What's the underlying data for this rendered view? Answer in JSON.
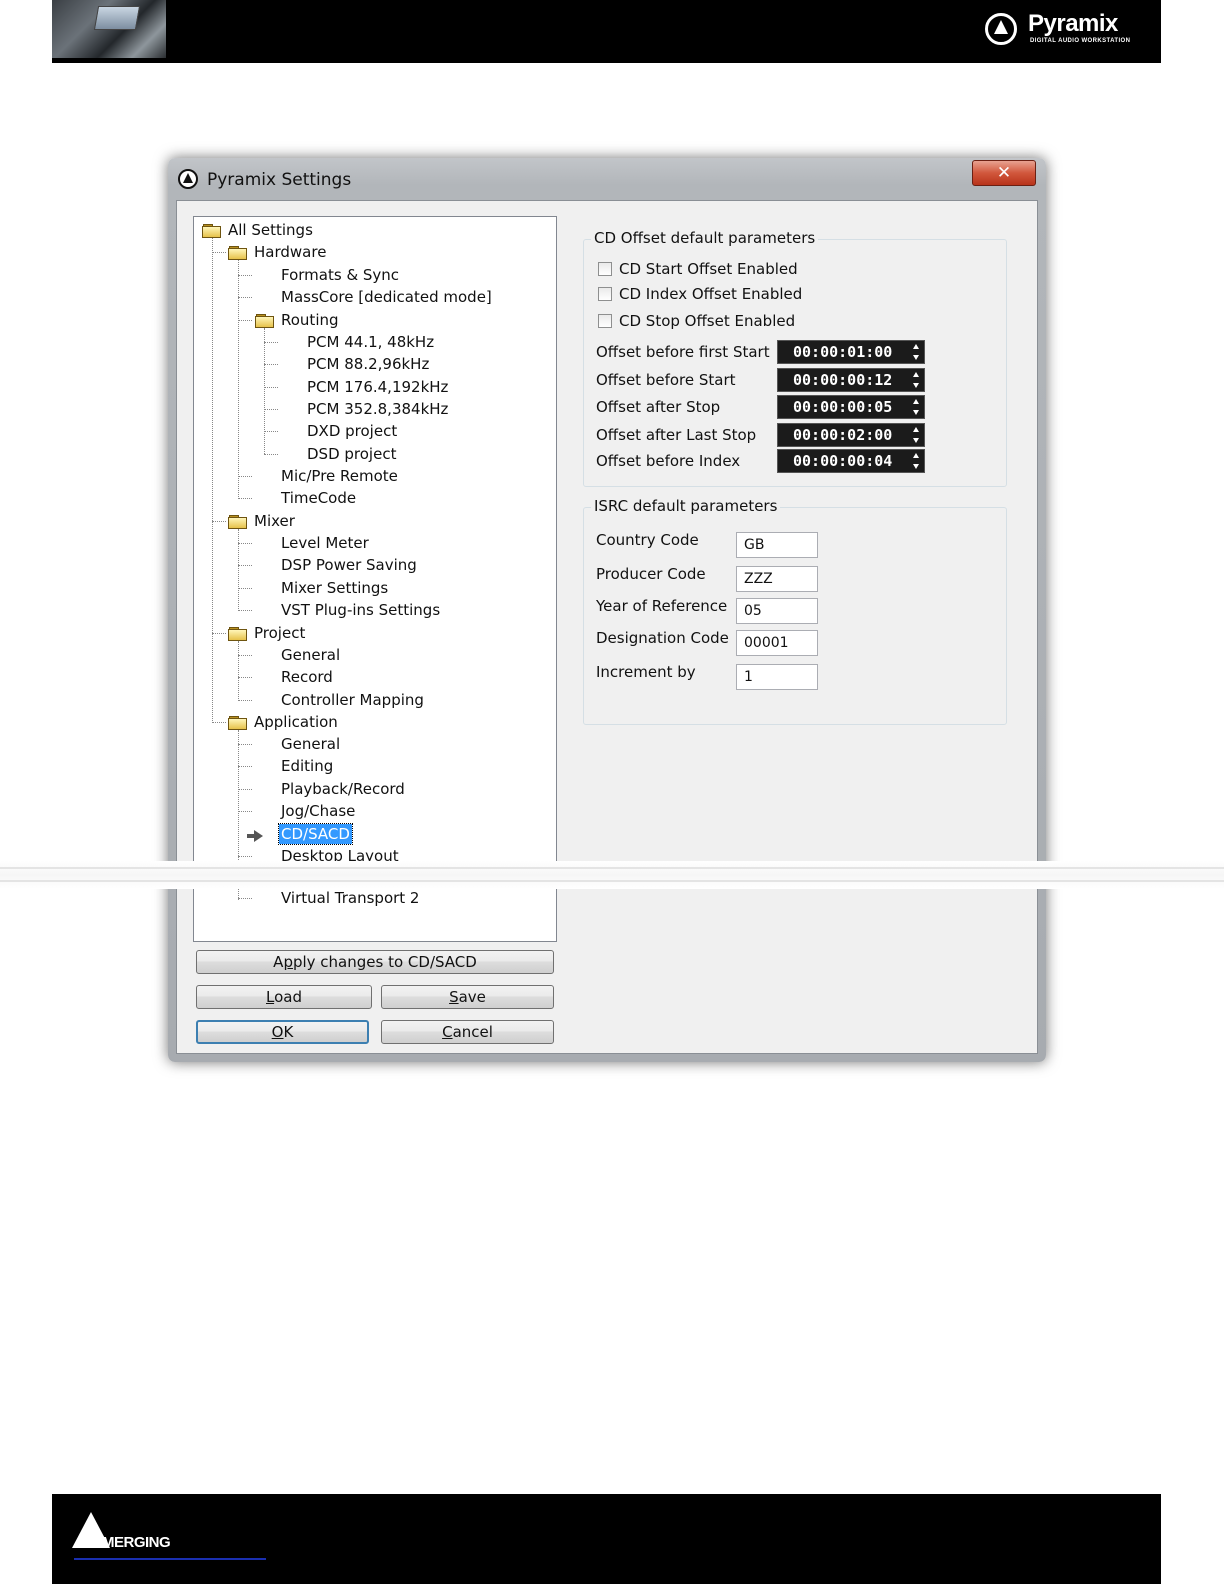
{
  "header": {
    "logo_text": "Pyramix",
    "logo_subtitle": "DIGITAL AUDIO WORKSTATION"
  },
  "footer": {
    "logo_text": "MERGING"
  },
  "dialog": {
    "title": "Pyramix Settings",
    "close_glyph": "✕",
    "tree": {
      "root": "All Settings",
      "hardware": "Hardware",
      "formats_sync": "Formats & Sync",
      "masscore": "MassCore [dedicated mode]",
      "routing": "Routing",
      "pcm1": "PCM 44.1, 48kHz",
      "pcm2": "PCM 88.2,96kHz",
      "pcm3": "PCM 176.4,192kHz",
      "pcm4": "PCM 352.8,384kHz",
      "dxd": "DXD project",
      "dsd": "DSD project",
      "micpre": "Mic/Pre Remote",
      "timecode": "TimeCode",
      "mixer": "Mixer",
      "level_meter": "Level Meter",
      "dsp_power": "DSP Power Saving",
      "mixer_settings": "Mixer Settings",
      "vst": "VST Plug-ins Settings",
      "project": "Project",
      "proj_general": "General",
      "record": "Record",
      "controller_mapping": "Controller Mapping",
      "application": "Application",
      "app_general": "General",
      "editing": "Editing",
      "playback_record": "Playback/Record",
      "jog_chase": "Jog/Chase",
      "cd_sacd": "CD/SACD",
      "desktop_layout": "Desktop Layout",
      "virtual_transport_2": "Virtual Transport 2"
    },
    "buttons": {
      "apply_prefix": "A",
      "apply_ul": "p",
      "apply_rest": "ply changes to CD/SACD",
      "load_ul": "L",
      "load_rest": "oad",
      "save_ul": "S",
      "save_rest": "ave",
      "ok_ul": "O",
      "ok_rest": "K",
      "cancel_ul": "C",
      "cancel_rest": "ancel"
    },
    "cd_offset": {
      "title": "CD Offset default parameters",
      "checkboxes": [
        {
          "label": "CD Start Offset Enabled",
          "checked": false
        },
        {
          "label": "CD Index Offset Enabled",
          "checked": false
        },
        {
          "label": "CD Stop Offset Enabled",
          "checked": false
        }
      ],
      "rows": [
        {
          "label": "Offset before first Start",
          "value": "00:00:01:00"
        },
        {
          "label": "Offset before Start",
          "value": "00:00:00:12"
        },
        {
          "label": "Offset after Stop",
          "value": "00:00:00:05"
        },
        {
          "label": "Offset after Last Stop",
          "value": "00:00:02:00"
        },
        {
          "label": "Offset before Index",
          "value": "00:00:00:04"
        }
      ]
    },
    "isrc": {
      "title": "ISRC default parameters",
      "rows": [
        {
          "label": "Country Code",
          "value": "GB"
        },
        {
          "label": "Producer Code",
          "value": "ZZZ"
        },
        {
          "label": "Year of Reference",
          "value": "05"
        },
        {
          "label": "Designation Code",
          "value": "00001"
        },
        {
          "label": "Increment by",
          "value": "1"
        }
      ]
    }
  }
}
